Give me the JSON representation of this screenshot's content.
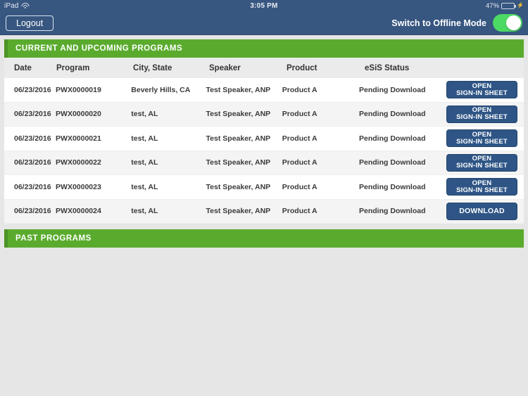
{
  "status_bar": {
    "carrier": "iPad",
    "wifi_icon": "wifi-icon",
    "time": "3:05 PM",
    "battery_percent": "47%",
    "battery_level": 47,
    "charging_icon": "lightning-bolt-icon"
  },
  "navbar": {
    "logout_label": "Logout",
    "offline_label": "Switch to Offline Mode",
    "toggle_on": true
  },
  "sections": {
    "current": "CURRENT AND UPCOMING PROGRAMS",
    "past": "PAST PROGRAMS"
  },
  "table": {
    "columns": [
      "Date",
      "Program",
      "City, State",
      "Speaker",
      "Product",
      "eSiS Status"
    ],
    "rows": [
      {
        "date": "06/23/2016",
        "program": "PWX0000019",
        "city_state": "Beverly Hills, CA",
        "speaker": "Test Speaker, ANP",
        "product": "Product A",
        "status": "Pending Download",
        "action_line1": "OPEN",
        "action_line2": "SIGN-IN SHEET"
      },
      {
        "date": "06/23/2016",
        "program": "PWX0000020",
        "city_state": "test, AL",
        "speaker": "Test Speaker, ANP",
        "product": "Product A",
        "status": "Pending Download",
        "action_line1": "OPEN",
        "action_line2": "SIGN-IN SHEET"
      },
      {
        "date": "06/23/2016",
        "program": "PWX0000021",
        "city_state": "test, AL",
        "speaker": "Test Speaker, ANP",
        "product": "Product A",
        "status": "Pending Download",
        "action_line1": "OPEN",
        "action_line2": "SIGN-IN SHEET"
      },
      {
        "date": "06/23/2016",
        "program": "PWX0000022",
        "city_state": "test, AL",
        "speaker": "Test Speaker, ANP",
        "product": "Product A",
        "status": "Pending Download",
        "action_line1": "OPEN",
        "action_line2": "SIGN-IN SHEET"
      },
      {
        "date": "06/23/2016",
        "program": "PWX0000023",
        "city_state": "test, AL",
        "speaker": "Test Speaker, ANP",
        "product": "Product A",
        "status": "Pending Download",
        "action_line1": "OPEN",
        "action_line2": "SIGN-IN SHEET"
      },
      {
        "date": "06/23/2016",
        "program": "PWX0000024",
        "city_state": "test, AL",
        "speaker": "Test Speaker, ANP",
        "product": "Product A",
        "status": "Pending Download",
        "action_line1": "DOWNLOAD",
        "action_line2": ""
      }
    ]
  },
  "colors": {
    "navy": "#375680",
    "green": "#5aab2d",
    "green_accent": "#4d9326",
    "button_blue": "#2e5585",
    "page_background": "#e6e6e6",
    "toggle_on": "#4cd964"
  }
}
